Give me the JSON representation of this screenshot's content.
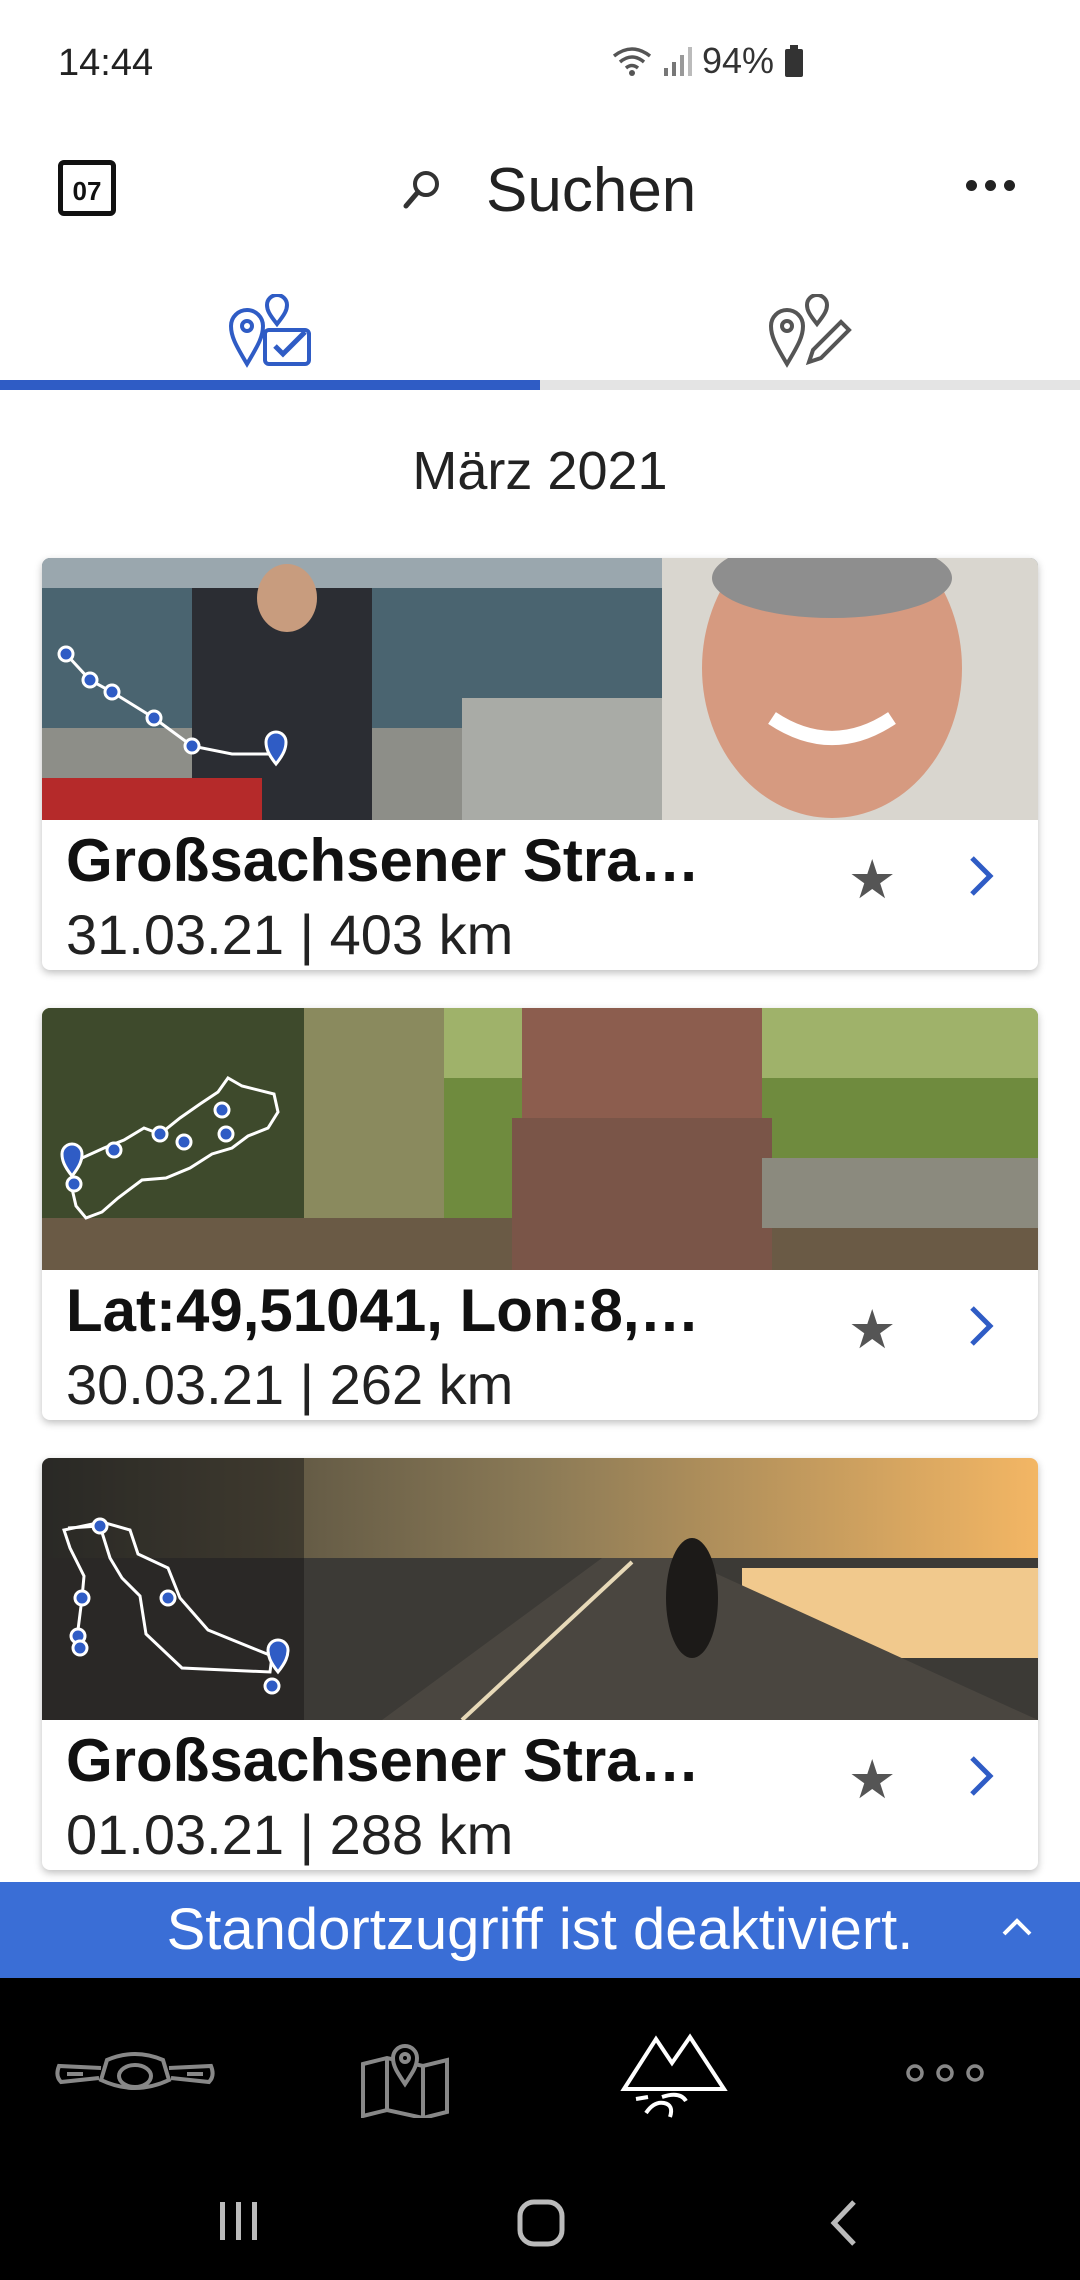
{
  "status": {
    "time": "14:44",
    "battery": "94%"
  },
  "header": {
    "calendar_day": "07",
    "search_label": "Suchen"
  },
  "tabs": [
    {
      "icon": "planned-routes-icon",
      "active": true
    },
    {
      "icon": "edit-route-icon",
      "active": false
    }
  ],
  "month": "März 2021",
  "trips": [
    {
      "title": "Großsachsener Stra…",
      "subtitle": "31.03.21 | 403 km"
    },
    {
      "title": "Lat:49,51041, Lon:8,…",
      "subtitle": "30.03.21 | 262 km"
    },
    {
      "title": "Großsachsener Stra…",
      "subtitle": "01.03.21 | 288 km"
    }
  ],
  "banner": {
    "text": "Standortzugriff ist deaktiviert."
  },
  "bottom_nav": [
    {
      "icon": "motorcycle-icon",
      "active": false
    },
    {
      "icon": "map-icon",
      "active": false
    },
    {
      "icon": "mountains-icon",
      "active": true
    },
    {
      "icon": "more-icon",
      "active": false
    }
  ],
  "colors": {
    "accent": "#2f5cc5",
    "banner": "#3a6ed6",
    "nav_bg": "#000000"
  }
}
